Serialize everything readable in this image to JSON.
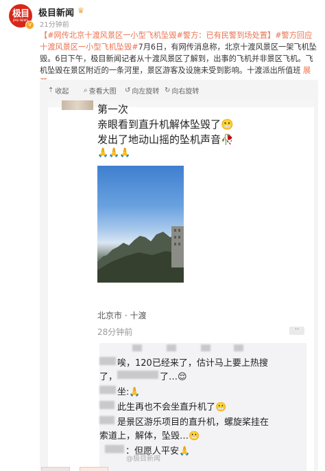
{
  "header": {
    "avatar_text": "极目",
    "avatar_sub": "JIMU NEWS",
    "verified_icon": "V",
    "author": "极目新闻",
    "crown_icon": "crown",
    "time": "21分钟前"
  },
  "post": {
    "topic1": "【#网传北京十渡风景区一小型飞机坠毁#警方：已有民警到场处置】",
    "topic2": "#警方回应十渡风景区一小型飞机坠毁#",
    "body1": "7月6日，有网传消息称，北京十渡风景区一架飞机坠毁。6日下午，极目新闻记者从十渡风景区了解到，出事的飞机并非景区飞机。飞机坠毁在景区附近的一条河里，景区游客及设施未受到影响。十渡派出所值班",
    "expand": "展开"
  },
  "toolbar": {
    "collapse": "收起",
    "view_large": "查看大图",
    "rotate_left": "向左旋转",
    "rotate_right": "向右旋转"
  },
  "screenshot": {
    "line1": "第一次",
    "line2": "亲眼看到直升机解体坠毁了😬",
    "line3": "发出了地动山摇的坠机声音🥀",
    "line4": "🙏🙏🙏",
    "location": "北京市 · 十渡",
    "ago": "28分钟前",
    "more_icon": "··",
    "comments": [
      {
        "text": "唉，120已经来了，估计马上要上热搜"
      },
      {
        "text": "了，"
      },
      {
        "text": "了…😌"
      },
      {
        "text": "坐:🙏"
      },
      {
        "text": "此生再也不会坐直升机了😬"
      },
      {
        "text": "是景区游乐项目的直升机，螺旋桨挂在"
      },
      {
        "text": "索道上，解体，坠毁…😬"
      },
      {
        "text": "：但愿人平安🙏"
      }
    ]
  },
  "watermark": "@极目新闻"
}
